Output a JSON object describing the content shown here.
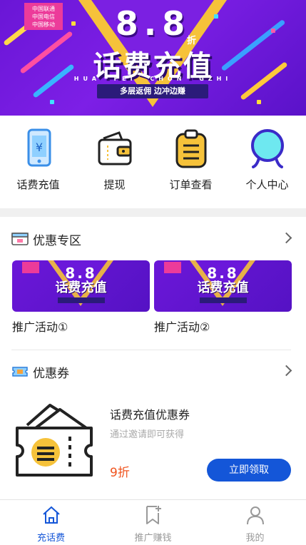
{
  "banner": {
    "flag_lines": [
      "中国联通",
      "中国电信",
      "中国移动"
    ],
    "headline_number": "8.8",
    "discount_char": "折",
    "title": "话费充值",
    "pinyin": "HUA FEI CHON GZHI",
    "tagline": "多层返佣  边冲边赚"
  },
  "quick_nav": [
    {
      "label": "话费充值",
      "icon": "phone-recharge-icon"
    },
    {
      "label": "提现",
      "icon": "wallet-icon"
    },
    {
      "label": "订单查看",
      "icon": "clipboard-icon"
    },
    {
      "label": "个人中心",
      "icon": "user-center-icon"
    }
  ],
  "promo_section": {
    "title": "优惠专区",
    "cards": [
      {
        "label": "推广活动①",
        "thumb_number": "8.8",
        "thumb_title": "话费充值"
      },
      {
        "label": "推广活动②",
        "thumb_number": "8.8",
        "thumb_title": "话费充值"
      }
    ]
  },
  "coupon_section": {
    "title": "优惠券",
    "coupon": {
      "name": "话费充值优惠券",
      "note": "通过邀请即可获得",
      "discount": "9折",
      "button_label": "立即领取"
    }
  },
  "tabbar": {
    "tabs": [
      {
        "label": "充话费",
        "icon": "home-icon",
        "active": true
      },
      {
        "label": "推广赚钱",
        "icon": "bookmark-add-icon",
        "active": false
      },
      {
        "label": "我的",
        "icon": "person-icon",
        "active": false
      }
    ]
  },
  "colors": {
    "brand_blue": "#1456d8",
    "banner_purple": "#7d1fe6",
    "accent_yellow": "#f6c23a",
    "discount_orange": "#f0541e"
  }
}
